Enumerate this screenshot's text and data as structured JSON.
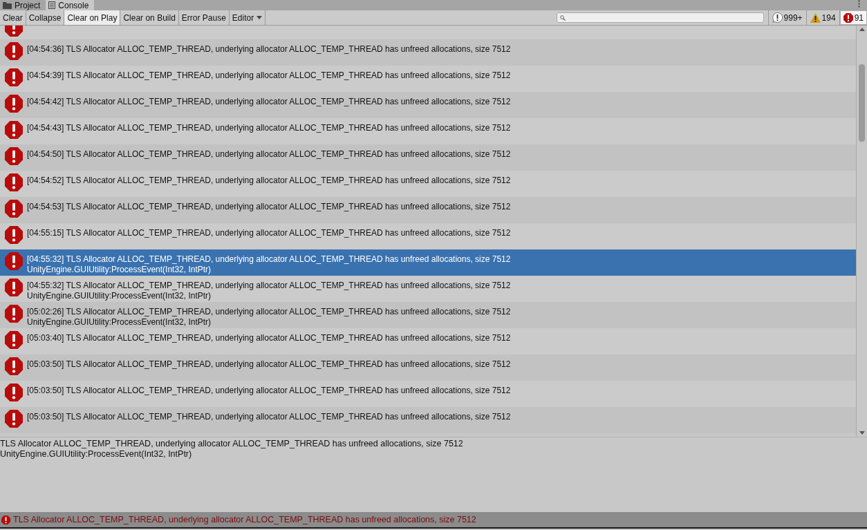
{
  "tabs": [
    {
      "label": "Project",
      "kind": "folder",
      "selected": false
    },
    {
      "label": "Console",
      "kind": "console",
      "selected": true
    }
  ],
  "toolbar": {
    "buttons": [
      {
        "label": "Clear",
        "kind": "button",
        "selected": false
      },
      {
        "label": "Collapse",
        "kind": "toggle",
        "selected": false
      },
      {
        "label": "Clear on Play",
        "kind": "toggle",
        "selected": true
      },
      {
        "label": "Clear on Build",
        "kind": "toggle",
        "selected": false
      },
      {
        "label": "Error Pause",
        "kind": "toggle",
        "selected": false
      },
      {
        "label": "Editor",
        "kind": "dropdown",
        "selected": false
      }
    ],
    "counters": [
      {
        "kind": "log",
        "count": "999+",
        "selected": false
      },
      {
        "kind": "warning",
        "count": "194",
        "selected": false
      },
      {
        "kind": "error",
        "count": "91",
        "selected": true
      }
    ]
  },
  "entries": [
    {
      "kind": "cut",
      "selected": false
    },
    {
      "kind": "error",
      "lines": [
        "[04:54:36] TLS Allocator ALLOC_TEMP_THREAD, underlying allocator ALLOC_TEMP_THREAD has unfreed allocations, size 7512"
      ],
      "selected": false
    },
    {
      "kind": "error",
      "lines": [
        "[04:54:39] TLS Allocator ALLOC_TEMP_THREAD, underlying allocator ALLOC_TEMP_THREAD has unfreed allocations, size 7512"
      ],
      "selected": false
    },
    {
      "kind": "error",
      "lines": [
        "[04:54:42] TLS Allocator ALLOC_TEMP_THREAD, underlying allocator ALLOC_TEMP_THREAD has unfreed allocations, size 7512"
      ],
      "selected": false
    },
    {
      "kind": "error",
      "lines": [
        "[04:54:43] TLS Allocator ALLOC_TEMP_THREAD, underlying allocator ALLOC_TEMP_THREAD has unfreed allocations, size 7512"
      ],
      "selected": false
    },
    {
      "kind": "error",
      "lines": [
        "[04:54:50] TLS Allocator ALLOC_TEMP_THREAD, underlying allocator ALLOC_TEMP_THREAD has unfreed allocations, size 7512"
      ],
      "selected": false
    },
    {
      "kind": "error",
      "lines": [
        "[04:54:52] TLS Allocator ALLOC_TEMP_THREAD, underlying allocator ALLOC_TEMP_THREAD has unfreed allocations, size 7512"
      ],
      "selected": false
    },
    {
      "kind": "error",
      "lines": [
        "[04:54:53] TLS Allocator ALLOC_TEMP_THREAD, underlying allocator ALLOC_TEMP_THREAD has unfreed allocations, size 7512"
      ],
      "selected": false
    },
    {
      "kind": "error",
      "lines": [
        "[04:55:15] TLS Allocator ALLOC_TEMP_THREAD, underlying allocator ALLOC_TEMP_THREAD has unfreed allocations, size 7512"
      ],
      "selected": false
    },
    {
      "kind": "error",
      "lines": [
        "[04:55:32] TLS Allocator ALLOC_TEMP_THREAD, underlying allocator ALLOC_TEMP_THREAD has unfreed allocations, size 7512",
        "UnityEngine.GUIUtility:ProcessEvent(Int32, IntPtr)"
      ],
      "selected": true
    },
    {
      "kind": "error",
      "lines": [
        "[04:55:32] TLS Allocator ALLOC_TEMP_THREAD, underlying allocator ALLOC_TEMP_THREAD has unfreed allocations, size 7512",
        "UnityEngine.GUIUtility:ProcessEvent(Int32, IntPtr)"
      ],
      "selected": false
    },
    {
      "kind": "error",
      "lines": [
        "[05:02:26] TLS Allocator ALLOC_TEMP_THREAD, underlying allocator ALLOC_TEMP_THREAD has unfreed allocations, size 7512",
        "UnityEngine.GUIUtility:ProcessEvent(Int32, IntPtr)"
      ],
      "selected": false
    },
    {
      "kind": "error",
      "lines": [
        "[05:03:40] TLS Allocator ALLOC_TEMP_THREAD, underlying allocator ALLOC_TEMP_THREAD has unfreed allocations, size 7512"
      ],
      "selected": false
    },
    {
      "kind": "error",
      "lines": [
        "[05:03:50] TLS Allocator ALLOC_TEMP_THREAD, underlying allocator ALLOC_TEMP_THREAD has unfreed allocations, size 7512"
      ],
      "selected": false
    },
    {
      "kind": "error",
      "lines": [
        "[05:03:50] TLS Allocator ALLOC_TEMP_THREAD, underlying allocator ALLOC_TEMP_THREAD has unfreed allocations, size 7512"
      ],
      "selected": false
    },
    {
      "kind": "error",
      "lines": [
        "[05:03:50] TLS Allocator ALLOC_TEMP_THREAD, underlying allocator ALLOC_TEMP_THREAD has unfreed allocations, size 7512"
      ],
      "selected": false
    }
  ],
  "detail": [
    "TLS Allocator ALLOC_TEMP_THREAD, underlying allocator ALLOC_TEMP_THREAD has unfreed allocations, size 7512",
    "UnityEngine.GUIUtility:ProcessEvent(Int32, IntPtr)"
  ],
  "status_bar": {
    "kind": "error",
    "text": "TLS Allocator ALLOC_TEMP_THREAD, underlying allocator ALLOC_TEMP_THREAD has unfreed allocations, size 7512"
  }
}
